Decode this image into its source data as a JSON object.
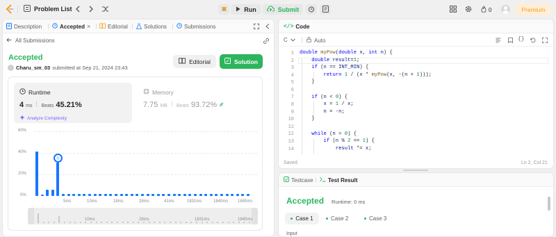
{
  "topbar": {
    "problem_list": "Problem List",
    "run": "Run",
    "submit": "Submit",
    "streak": "0",
    "premium": "Premium"
  },
  "left_tabs": {
    "description": "Description",
    "accepted": "Accepted",
    "editorial": "Editorial",
    "solutions": "Solutions",
    "submissions": "Submissions"
  },
  "submission": {
    "back": "All Submissions",
    "status": "Accepted",
    "user": "Charu_sm_03",
    "submitted_text": "submitted at Sep 21, 2024 23:43",
    "editorial_btn": "Editorial",
    "solution_btn": "Solution",
    "runtime_label": "Runtime",
    "runtime_value": "4",
    "runtime_unit": "ms",
    "beats_label": "Beats",
    "runtime_beats": "45.21%",
    "analyze": "Analyze Complexity",
    "memory_label": "Memory",
    "memory_value": "7.75",
    "memory_unit": "MB",
    "memory_beats": "93.72%"
  },
  "chart_data": {
    "type": "bar",
    "y_ticks": [
      "60%",
      "40%",
      "20%",
      "0%"
    ],
    "x_ticks": [
      "5ms",
      "10ms",
      "18ms",
      "28ms",
      "41ms",
      "1831ms",
      "1840ms",
      "1845ms"
    ],
    "range_ticks": [
      "10ms",
      "28ms",
      "1831ms",
      "1845ms"
    ],
    "ylim": [
      0,
      60
    ],
    "values": [
      41,
      1,
      6,
      6,
      31,
      2,
      2,
      2,
      2,
      2,
      2,
      2,
      2,
      2,
      2,
      2,
      2,
      2,
      2,
      2,
      2,
      2,
      2,
      2,
      2,
      2,
      2,
      2,
      2,
      2,
      2,
      2,
      2,
      2,
      2,
      2,
      2,
      2,
      2,
      2,
      2
    ],
    "highlight_index": 4,
    "bar_color": "#1677ff"
  },
  "code": {
    "tab": "Code",
    "language": "C",
    "mode": "Auto",
    "saved": "Saved",
    "cursor": "Ln 2, Col 21",
    "line_numbers": [
      "1",
      "2",
      "3",
      "4",
      "5",
      "6",
      "7",
      "8",
      "9",
      "10",
      "11",
      "12",
      "13",
      "14"
    ]
  },
  "testpanel": {
    "testcase_tab": "Testcase",
    "result_tab": "Test Result",
    "status": "Accepted",
    "runtime": "Runtime: 0 ms",
    "cases": [
      "Case 1",
      "Case 2",
      "Case 3"
    ],
    "input_label": "Input"
  }
}
